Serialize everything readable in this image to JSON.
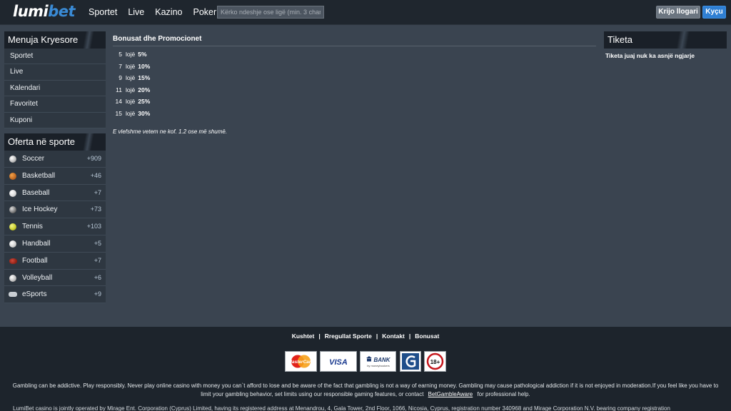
{
  "header": {
    "logo_main": "lumi",
    "logo_accent": "bet",
    "nav": [
      "Sportet",
      "Live",
      "Kazino",
      "Poker"
    ],
    "search_placeholder": "Kërko ndeshje ose ligë (min. 3 char",
    "register_label": "Krijo llogari",
    "login_label": "Kyçu"
  },
  "main_menu": {
    "title": "Menuja Kryesore",
    "items": [
      "Sportet",
      "Live",
      "Kalendari",
      "Favoritet",
      "Kuponi"
    ]
  },
  "sports_menu": {
    "title": "Oferta në sporte",
    "items": [
      {
        "label": "Soccer",
        "count": "+909",
        "icon": "soccer-icon"
      },
      {
        "label": "Basketball",
        "count": "+46",
        "icon": "basketball-icon"
      },
      {
        "label": "Baseball",
        "count": "+7",
        "icon": "baseball-icon"
      },
      {
        "label": "Ice Hockey",
        "count": "+73",
        "icon": "ice-hockey-icon"
      },
      {
        "label": "Tennis",
        "count": "+103",
        "icon": "tennis-icon"
      },
      {
        "label": "Handball",
        "count": "+5",
        "icon": "handball-icon"
      },
      {
        "label": "Football",
        "count": "+7",
        "icon": "football-icon"
      },
      {
        "label": "Volleyball",
        "count": "+6",
        "icon": "volleyball-icon"
      },
      {
        "label": "eSports",
        "count": "+9",
        "icon": "gamepad-icon"
      }
    ]
  },
  "content": {
    "title": "Bonusat dhe Promocionet",
    "bonuses": [
      {
        "games": "5",
        "unit": "lojë",
        "percent": "5%"
      },
      {
        "games": "7",
        "unit": "lojë",
        "percent": "10%"
      },
      {
        "games": "9",
        "unit": "lojë",
        "percent": "15%"
      },
      {
        "games": "11",
        "unit": "lojë",
        "percent": "20%"
      },
      {
        "games": "14",
        "unit": "lojë",
        "percent": "25%"
      },
      {
        "games": "15",
        "unit": "lojë",
        "percent": "30%"
      }
    ],
    "note": "E vlefshme vetem ne kof. 1.2 ose më shumë."
  },
  "ticket": {
    "title": "Tiketa",
    "message": "Tiketa juaj nuk ka asnjë ngjarje"
  },
  "footer": {
    "links": [
      "Kushtet",
      "Rregullat Sporte",
      "Kontakt",
      "Bonusat"
    ],
    "separator": "|",
    "payment_labels": {
      "mastercard": "MasterCard",
      "visa": "VISA",
      "bank": "BANK",
      "bank_sub": "by moneybookers",
      "adult": "18+"
    },
    "disclaimer_pre": "Gambling can be addictive. Play responsibly. Never play online casino with money you can`t afford to lose and be aware of the fact that gambling is not a way of earning money. Gambling may cause pathological addiction if it is not enjoyed in moderation.If you feel like you have to limit your gambling behavior, set limits using our responsible gaming features, or contact",
    "disclaimer_link": "BetGambleAware",
    "disclaimer_post": "for professional help.",
    "legal": "LumiBet casino is jointly operated by Mirage Ent. Corporation (Cyprus) Limited, having its registered address at Menandrou, 4, Gala Tower, 2nd Floor, 1066, Nicosia, Cyprus, registration number 340968 and Mirage Corporation N.V. bearing company registration"
  },
  "colors": {
    "background": "#3a4450",
    "header": "#1f262e",
    "accent": "#2f7fd3",
    "sidebar_item": "#2e3741"
  }
}
